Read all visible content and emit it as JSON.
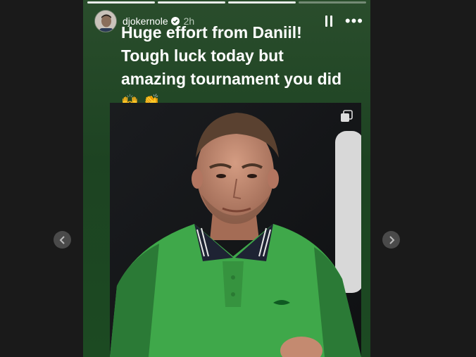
{
  "story": {
    "username": "djokernole",
    "time": "2h",
    "caption_lines": [
      "Huge effort from Daniil!",
      "Tough luck today but",
      "amazing tournament you did"
    ],
    "emoji": "🙌 👏"
  },
  "icons": {
    "prev": "chevron-left-icon",
    "next": "chevron-right-icon",
    "pause": "pause-icon",
    "more": "more-icon",
    "verified": "verified-badge-icon",
    "multi": "carousel-icon"
  },
  "colors": {
    "story_bg": "#1d4322",
    "shirt": "#3fa84a",
    "page_bg": "#1a1a1a"
  }
}
